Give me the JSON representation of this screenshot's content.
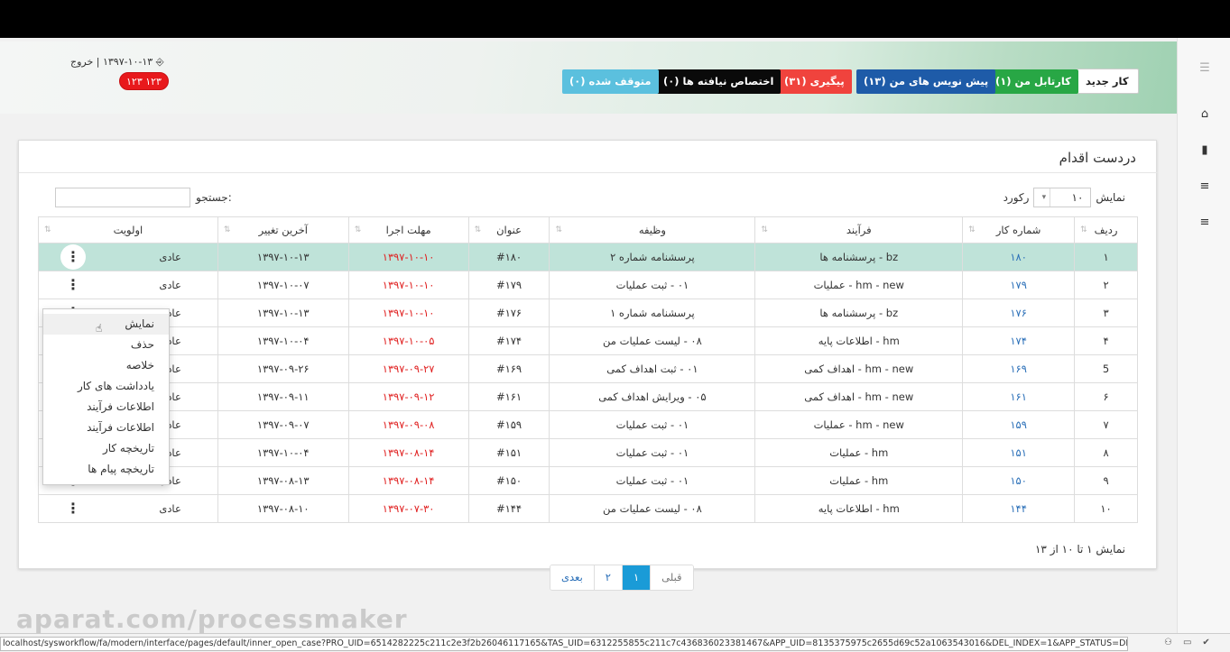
{
  "header": {
    "user_line": "۱۳۹۷-۱۰-۱۳ | خروج",
    "badge": "۱۲۳ ۱۲۳",
    "buttons": [
      {
        "label": "کار جدید",
        "color": "#ffffff"
      },
      {
        "label": "کارتابل من (۱)",
        "color": "#28a745"
      },
      {
        "label": "پیش نویس های من (۱۳)",
        "color": "#1e5ba8"
      },
      {
        "label": "پیگیری (۳۱)",
        "color": "#f0433d"
      },
      {
        "label": "اختصاص نیافته ها (۰)",
        "color": "#0a0a0a"
      },
      {
        "label": "متوقف شده (۰)",
        "color": "#5bc0de"
      }
    ]
  },
  "panel": {
    "title": "دردست اقدام",
    "show_label": "نمایش",
    "records_label": "رکورد",
    "length_value": "۱۰",
    "search_label": "جستجو:",
    "footer_info": "نمایش ۱ تا ۱۰ از ۱۳"
  },
  "table": {
    "columns": [
      "ردیف",
      "شماره کار",
      "فرآیند",
      "وظیفه",
      "عنوان",
      "مهلت اجرا",
      "آخرین تغییر",
      "اولویت"
    ],
    "rows": [
      [
        "۱",
        "۱۸۰",
        "bz - پرسشنامه ها",
        "پرسشنامه شماره ۲",
        "#۱۸۰",
        "۱۳۹۷-۱۰-۱۰",
        "۱۳۹۷-۱۰-۱۳",
        "عادی"
      ],
      [
        "۲",
        "۱۷۹",
        "hm - new - عملیات",
        "۰۱ - ثبت عملیات",
        "#۱۷۹",
        "۱۳۹۷-۱۰-۱۰",
        "۱۳۹۷-۱۰-۰۷",
        "عادی"
      ],
      [
        "۳",
        "۱۷۶",
        "bz - پرسشنامه ها",
        "پرسشنامه شماره ۱",
        "#۱۷۶",
        "۱۳۹۷-۱۰-۱۰",
        "۱۳۹۷-۱۰-۱۳",
        "عادی"
      ],
      [
        "۴",
        "۱۷۴",
        "hm - اطلاعات پایه",
        "۰۸ - لیست عملیات من",
        "#۱۷۴",
        "۱۳۹۷-۱۰-۰۵",
        "۱۳۹۷-۱۰-۰۴",
        "عادی"
      ],
      [
        "5",
        "۱۶۹",
        "hm - new - اهداف کمی",
        "۰۱ - ثبت اهداف کمی",
        "#۱۶۹",
        "۱۳۹۷-۰۹-۲۷",
        "۱۳۹۷-۰۹-۲۶",
        "عادی"
      ],
      [
        "۶",
        "۱۶۱",
        "hm - new - اهداف کمی",
        "۰۵ - ویرایش اهداف کمی",
        "#۱۶۱",
        "۱۳۹۷-۰۹-۱۲",
        "۱۳۹۷-۰۹-۱۱",
        "عادی"
      ],
      [
        "۷",
        "۱۵۹",
        "hm - new - عملیات",
        "۰۱ - ثبت عملیات",
        "#۱۵۹",
        "۱۳۹۷-۰۹-۰۸",
        "۱۳۹۷-۰۹-۰۷",
        "عادی"
      ],
      [
        "۸",
        "۱۵۱",
        "hm - عملیات",
        "۰۱ - ثبت عملیات",
        "#۱۵۱",
        "۱۳۹۷-۰۸-۱۴",
        "۱۳۹۷-۱۰-۰۴",
        "عادی"
      ],
      [
        "۹",
        "۱۵۰",
        "hm - عملیات",
        "۰۱ - ثبت عملیات",
        "#۱۵۰",
        "۱۳۹۷-۰۸-۱۴",
        "۱۳۹۷-۰۸-۱۳",
        "عادی"
      ],
      [
        "۱۰",
        "۱۴۴",
        "hm - اطلاعات پایه",
        "۰۸ - لیست عملیات من",
        "#۱۴۴",
        "۱۳۹۷-۰۷-۳۰",
        "۱۳۹۷-۰۸-۱۰",
        "عادی"
      ]
    ]
  },
  "dropdown": {
    "items": [
      "نمایش",
      "حذف",
      "خلاصه",
      "یادداشت های کار",
      "اطلاعات فرآیند",
      "اطلاعات فرآیند",
      "تاریخچه کار",
      "تاریخچه پیام ها"
    ]
  },
  "pager": {
    "prev": "قبلی",
    "page1": "۱",
    "page2": "۲",
    "next": "بعدی"
  },
  "watermark": "aparat.com/processmaker",
  "statusbar": {
    "url": "localhost/sysworkflow/fa/modern/interface/pages/default/inner_open_case?PRO_UID=6514282225c211c2e3f2b26046117165&TAS_UID=6312255855c211c7c436836023381467&APP_UID=8135375975c2655d69c52a1063543016&DEL_INDEX=1&APP_STATUS=DRAFT"
  }
}
